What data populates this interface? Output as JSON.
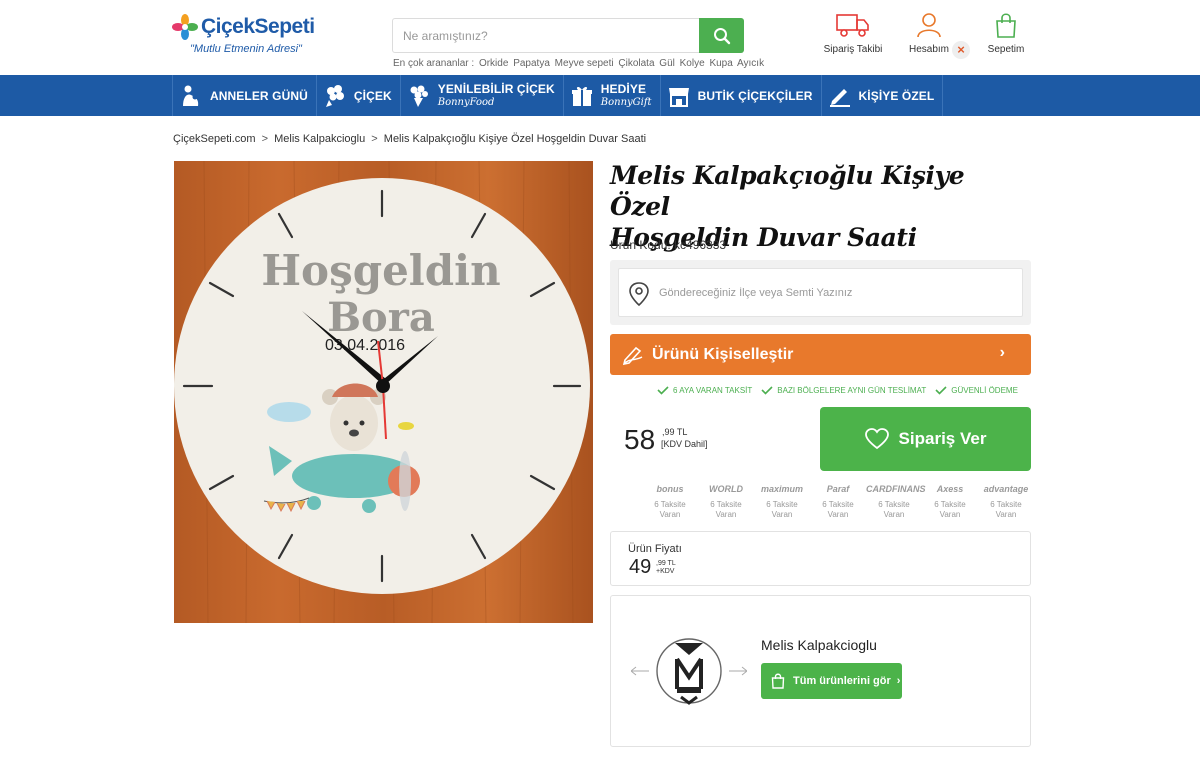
{
  "header": {
    "logo_name": "ÇiçekSepeti",
    "logo_slogan": "\"Mutlu Etmenin Adresi\"",
    "search_placeholder": "Ne aramıştınız?",
    "popular_label": "En çok arananlar :",
    "popular_terms": [
      "Orkide",
      "Papatya",
      "Meyve sepeti",
      "Çikolata",
      "Gül",
      "Kolye",
      "Kupa",
      "Ayıcık"
    ],
    "orders_label": "Sipariş Takibi",
    "account_label": "Hesabım",
    "account_close": "×",
    "cart_label": "Sepetim",
    "accent_color": "#4caf50",
    "brand_color": "#1f5ba8"
  },
  "nav": {
    "items": [
      {
        "label": "ANNELER GÜNÜ",
        "icon": "mother-child-icon"
      },
      {
        "label": "ÇİÇEK",
        "icon": "bouquet-icon"
      },
      {
        "label": "YENİLEBİLİR ÇİÇEK",
        "sub": "BonnyFood",
        "icon": "fruit-bouquet-icon"
      },
      {
        "label": "HEDİYE",
        "sub": "BonnyGift",
        "icon": "gift-icon"
      },
      {
        "label": "BUTİK ÇİÇEKÇİLER",
        "icon": "shop-icon"
      },
      {
        "label": "KİŞİYE ÖZEL",
        "icon": "pen-icon"
      }
    ],
    "bar_color": "#1d5aa5"
  },
  "breadcrumb": {
    "items": [
      "ÇiçekSepeti.com",
      "Melis Kalpakcioglu",
      "Melis Kalpakçıoğlu Kişiye Özel Hoşgeldin Duvar Saati"
    ],
    "separator": ">"
  },
  "product": {
    "clock_text_line1": "Hoşgeldin",
    "clock_text_line2": "Bora",
    "clock_date": "03.04.2016",
    "title_line1": "Melis Kalpakçıoğlu Kişiye Özel",
    "title_line2": "Hoşgeldin Duvar Saati",
    "sku": "Ürün Kodu: kc496333",
    "location_placeholder": "Göndereceğiniz İlçe veya Semti Yazınız",
    "personalize_label": "Ürünü Kişiselleştir",
    "personalize_chevron": "›",
    "features": [
      "6 AYA VARAN TAKSİT",
      "BAZI BÖLGELERE AYNI GÜN TESLİMAT",
      "GÜVENLİ ÖDEME"
    ],
    "price_int": "58",
    "price_dec": ",99 TL",
    "price_vat": "[KDV Dahil]",
    "order_label": "Sipariş Ver",
    "order_color": "#4cb34a",
    "personalize_color": "#e8792c"
  },
  "cards": [
    {
      "name": "bonus",
      "line1": "6 Taksite",
      "line2": "Varan"
    },
    {
      "name": "WORLD",
      "line1": "6 Taksite",
      "line2": "Varan"
    },
    {
      "name": "maximum",
      "line1": "6 Taksite",
      "line2": "Varan"
    },
    {
      "name": "Paraf",
      "line1": "6 Taksite",
      "line2": "Varan"
    },
    {
      "name": "CARDFINANS",
      "line1": "6 Taksite",
      "line2": "Varan"
    },
    {
      "name": "Axess",
      "line1": "6 Taksite",
      "line2": "Varan"
    },
    {
      "name": "advantage",
      "line1": "6 Taksite",
      "line2": "Varan"
    }
  ],
  "unit_price": {
    "label": "Ürün Fiyatı",
    "int": "49",
    "dec": ",99 TL",
    "vat": "+KDV"
  },
  "seller": {
    "name": "Melis Kalpakcioglu",
    "button_label": "Tüm ürünlerini gör",
    "button_chevron": "›"
  }
}
